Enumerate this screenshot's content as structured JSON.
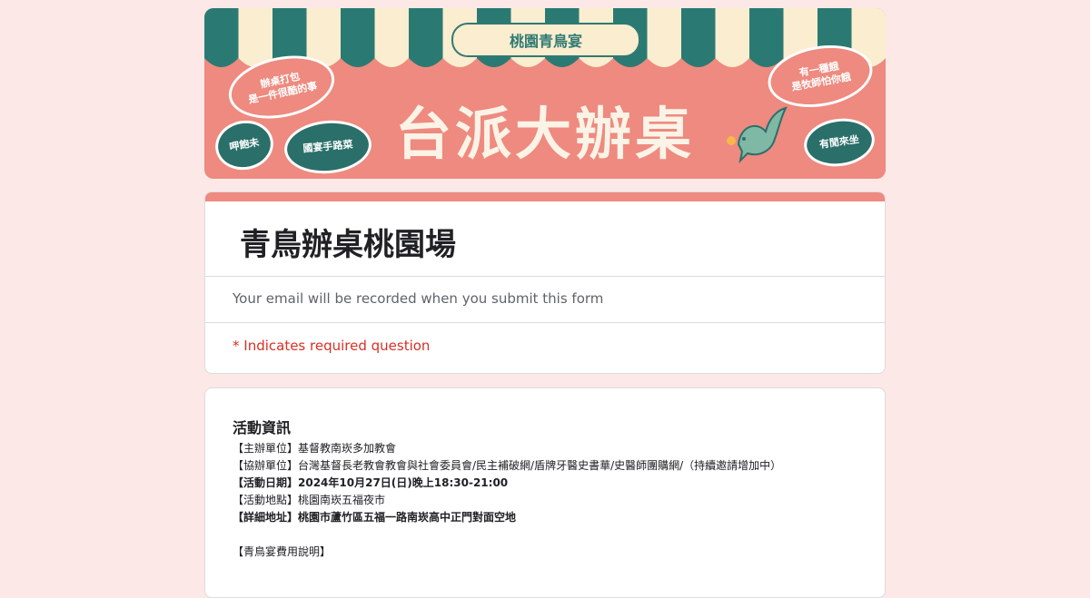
{
  "banner": {
    "small_title": "桃園青鳥宴",
    "big_title": "台派大辦桌",
    "bubbles": {
      "b1": "辦桌打包\n是一件很酷的事",
      "b2": "有一種餓\n是牧師怕你餓",
      "b3": "呷飽未",
      "b4": "國宴手路菜",
      "b5": "有閒來坐"
    }
  },
  "form": {
    "title": "青鳥辦桌桃園場",
    "email_note": "Your email will be recorded when you submit this form",
    "required_note": "* Indicates required question"
  },
  "info": {
    "heading": "活動資訊",
    "lines": [
      "【主辦單位】基督教南崁多加教會",
      "【協辦單位】台灣基督長老教會教會與社會委員會/民主補破網/盾牌牙醫史書華/史醫師團購網/（持續邀請增加中）",
      "【活動日期】2024年10月27日(日)晚上18:30-21:00",
      "【活動地點】桃園南崁五福夜市",
      "【詳細地址】桃園市蘆竹區五福一路南崁高中正門對面空地",
      "",
      "【青鳥宴費用說明】"
    ]
  },
  "colors": {
    "background": "#fce8e6",
    "accent": "#ee8a7f",
    "teal": "#2a6f6a",
    "required": "#d93025"
  }
}
